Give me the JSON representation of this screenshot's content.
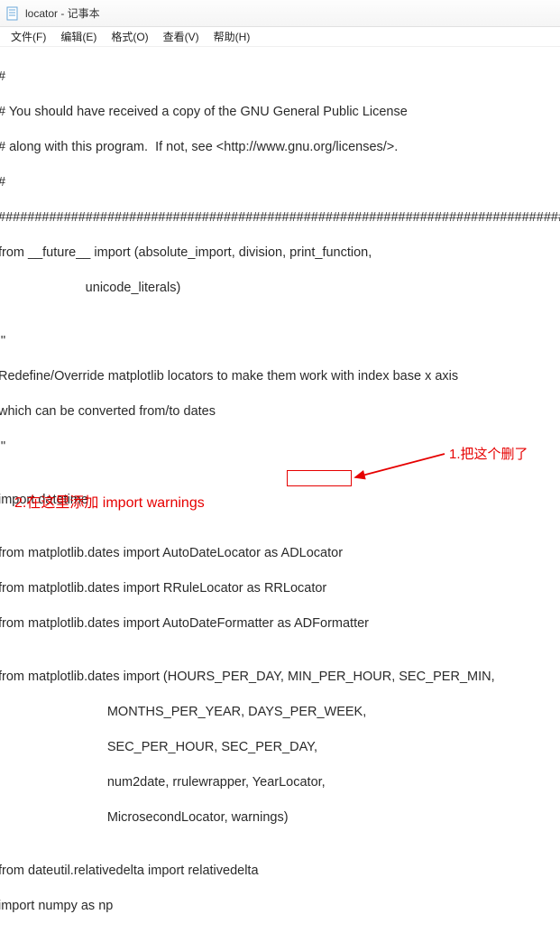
{
  "window": {
    "title": "locator - 记事本"
  },
  "menu": {
    "file": "文件(F)",
    "edit": "编辑(E)",
    "format": "格式(O)",
    "view": "查看(V)",
    "help": "帮助(H)"
  },
  "lines": {
    "l1": "#",
    "l2": "# You should have received a copy of the GNU General Public License",
    "l3": "# along with this program.  If not, see <http://www.gnu.org/licenses/>.",
    "l4": "#",
    "l5": "###############################################################################",
    "l6": "from __future__ import (absolute_import, division, print_function,",
    "l7": "                        unicode_literals)",
    "l8": "",
    "l9": "'''",
    "l10": "Redefine/Override matplotlib locators to make them work with index base x axis",
    "l11": "which can be converted from/to dates",
    "l12": "'''",
    "l13": "",
    "l14": "import datetime",
    "l15": "",
    "l16": "from matplotlib.dates import AutoDateLocator as ADLocator",
    "l17": "from matplotlib.dates import RRuleLocator as RRLocator",
    "l18": "from matplotlib.dates import AutoDateFormatter as ADFormatter",
    "l19": "",
    "l20": "from matplotlib.dates import (HOURS_PER_DAY, MIN_PER_HOUR, SEC_PER_MIN,",
    "l21": "                              MONTHS_PER_YEAR, DAYS_PER_WEEK,",
    "l22": "                              SEC_PER_HOUR, SEC_PER_DAY,",
    "l23": "                              num2date, rrulewrapper, YearLocator,",
    "l24": "                              MicrosecondLocator, warnings)",
    "l25": "",
    "l26": "from dateutil.relativedelta import relativedelta",
    "l27": "import numpy as np"
  },
  "annotations": {
    "a1": "1.把这个删了",
    "a2": "2.在这里添加 import warnings"
  }
}
